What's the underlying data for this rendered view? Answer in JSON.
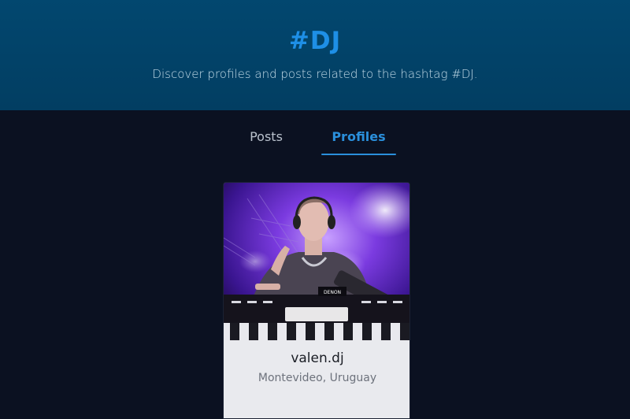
{
  "header": {
    "title": "#DJ",
    "subtitle": "Discover profiles and posts related to the hashtag #DJ."
  },
  "tabs": [
    {
      "label": "Posts",
      "active": false
    },
    {
      "label": "Profiles",
      "active": true
    }
  ],
  "profiles": [
    {
      "name": "valen.dj",
      "location": "Montevideo, Uruguay",
      "image": "dj-performing-photo",
      "mixer_brand": "DENON"
    }
  ],
  "colors": {
    "accent": "#1e8fe6",
    "hero_bg": "#02476f",
    "page_bg": "#0b1121",
    "card_bg": "#e9eaee"
  }
}
